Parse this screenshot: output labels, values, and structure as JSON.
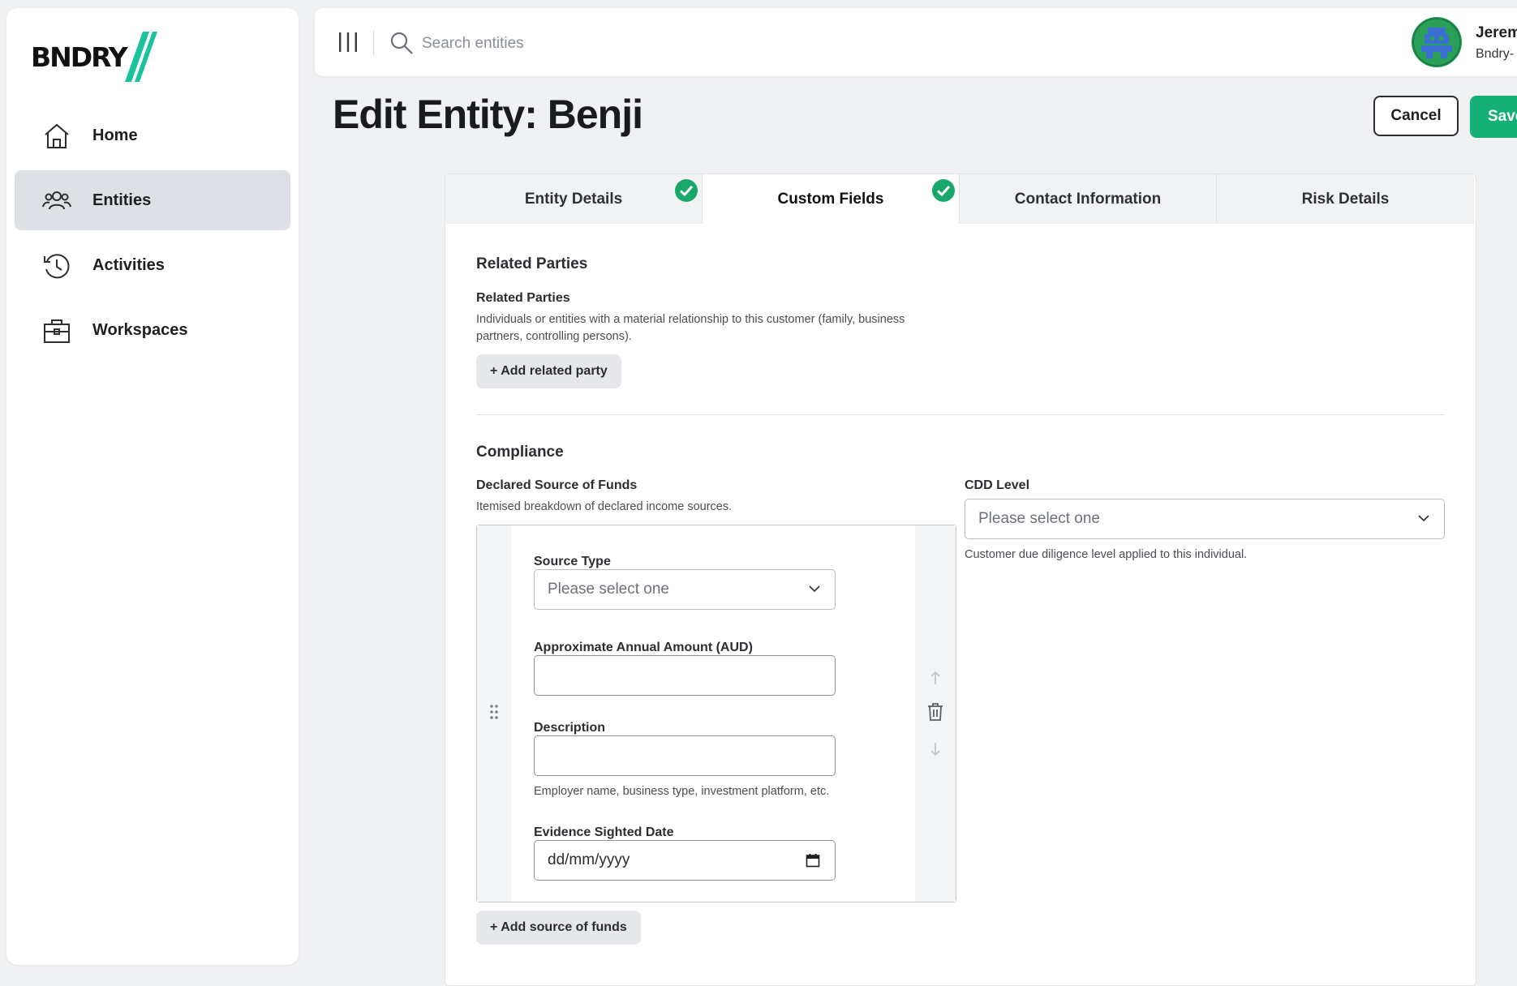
{
  "brand": {
    "logo_text": "BNDRY",
    "accent_color": "#19c39c"
  },
  "sidebar": {
    "items": [
      {
        "label": "Home",
        "icon": "home-icon",
        "active": false
      },
      {
        "label": "Entities",
        "icon": "users-icon",
        "active": true
      },
      {
        "label": "Activities",
        "icon": "history-icon",
        "active": false
      },
      {
        "label": "Workspaces",
        "icon": "briefcase-icon",
        "active": false
      }
    ]
  },
  "topbar": {
    "search_placeholder": "Search entities",
    "user_name": "Jeremy",
    "user_org": "Bndry-"
  },
  "page": {
    "title": "Edit Entity: Benji",
    "cancel_label": "Cancel",
    "save_label": "Save"
  },
  "tabs": [
    {
      "label": "Entity Details",
      "complete": true,
      "active": false
    },
    {
      "label": "Custom Fields",
      "complete": true,
      "active": true
    },
    {
      "label": "Contact Information",
      "complete": false,
      "active": false
    },
    {
      "label": "Risk Details",
      "complete": false,
      "active": false
    }
  ],
  "related_parties": {
    "section_title": "Related Parties",
    "field_label": "Related Parties",
    "help_text": "Individuals or entities with a material relationship to this customer (family, business partners, controlling persons).",
    "add_button": "+ Add related party"
  },
  "compliance": {
    "section_title": "Compliance",
    "funds_label": "Declared Source of Funds",
    "funds_help": "Itemised breakdown of declared income sources.",
    "source_type_label": "Source Type",
    "source_type_placeholder": "Please select one",
    "amount_label": "Approximate Annual Amount (AUD)",
    "amount_value": "",
    "description_label": "Description",
    "description_value": "",
    "description_help": "Employer name, business type, investment platform, etc.",
    "evidence_label": "Evidence Sighted Date",
    "evidence_value": "dd/mm/yyyy",
    "add_funds_button": "+ Add source of funds",
    "cdd_label": "CDD Level",
    "cdd_placeholder": "Please select one",
    "cdd_help": "Customer due diligence level applied to this individual."
  },
  "colors": {
    "success": "#1aa86a",
    "primary_button": "#14b075"
  }
}
